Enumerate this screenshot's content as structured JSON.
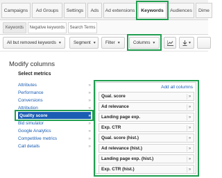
{
  "tabs": [
    {
      "label": "Campaigns"
    },
    {
      "label": "Ad Groups"
    },
    {
      "label": "Settings"
    },
    {
      "label": "Ads"
    },
    {
      "label": "Ad extensions"
    },
    {
      "label": "Keywords"
    },
    {
      "label": "Audiences"
    },
    {
      "label": "Dime"
    }
  ],
  "subtabs": [
    {
      "label": "Keywords"
    },
    {
      "label": "Negative keywords"
    },
    {
      "label": "Search Terms"
    }
  ],
  "toolbar": {
    "filter_all_label": "All but removed keywords",
    "segment_label": "Segment",
    "filter_label": "Filter",
    "columns_label": "Columns",
    "chart_icon": "line-chart-icon",
    "download_icon": "download-icon"
  },
  "panel": {
    "title": "Modify columns",
    "subtitle": "Select metrics",
    "categories": [
      {
        "label": "Attributes"
      },
      {
        "label": "Performance"
      },
      {
        "label": "Conversions"
      },
      {
        "label": "Attribution"
      },
      {
        "label": "Quality score"
      },
      {
        "label": "Bid simulator"
      },
      {
        "label": "Google Analytics"
      },
      {
        "label": "Competitive metrics"
      },
      {
        "label": "Call details"
      }
    ],
    "add_all_label": "Add all columns",
    "metrics": [
      {
        "label": "Qual. score"
      },
      {
        "label": "Ad relevance"
      },
      {
        "label": "Landing page exp."
      },
      {
        "label": "Exp. CTR"
      },
      {
        "label": "Qual. score (hist.)"
      },
      {
        "label": "Ad relevance (hist.)"
      },
      {
        "label": "Landing page exp. (hist.)"
      },
      {
        "label": "Exp. CTR (hist.)"
      }
    ],
    "arrow_glyph": "»",
    "plus_glyph": "»"
  },
  "colors": {
    "highlight": "#1e9e4f",
    "link": "#1a5db3"
  }
}
